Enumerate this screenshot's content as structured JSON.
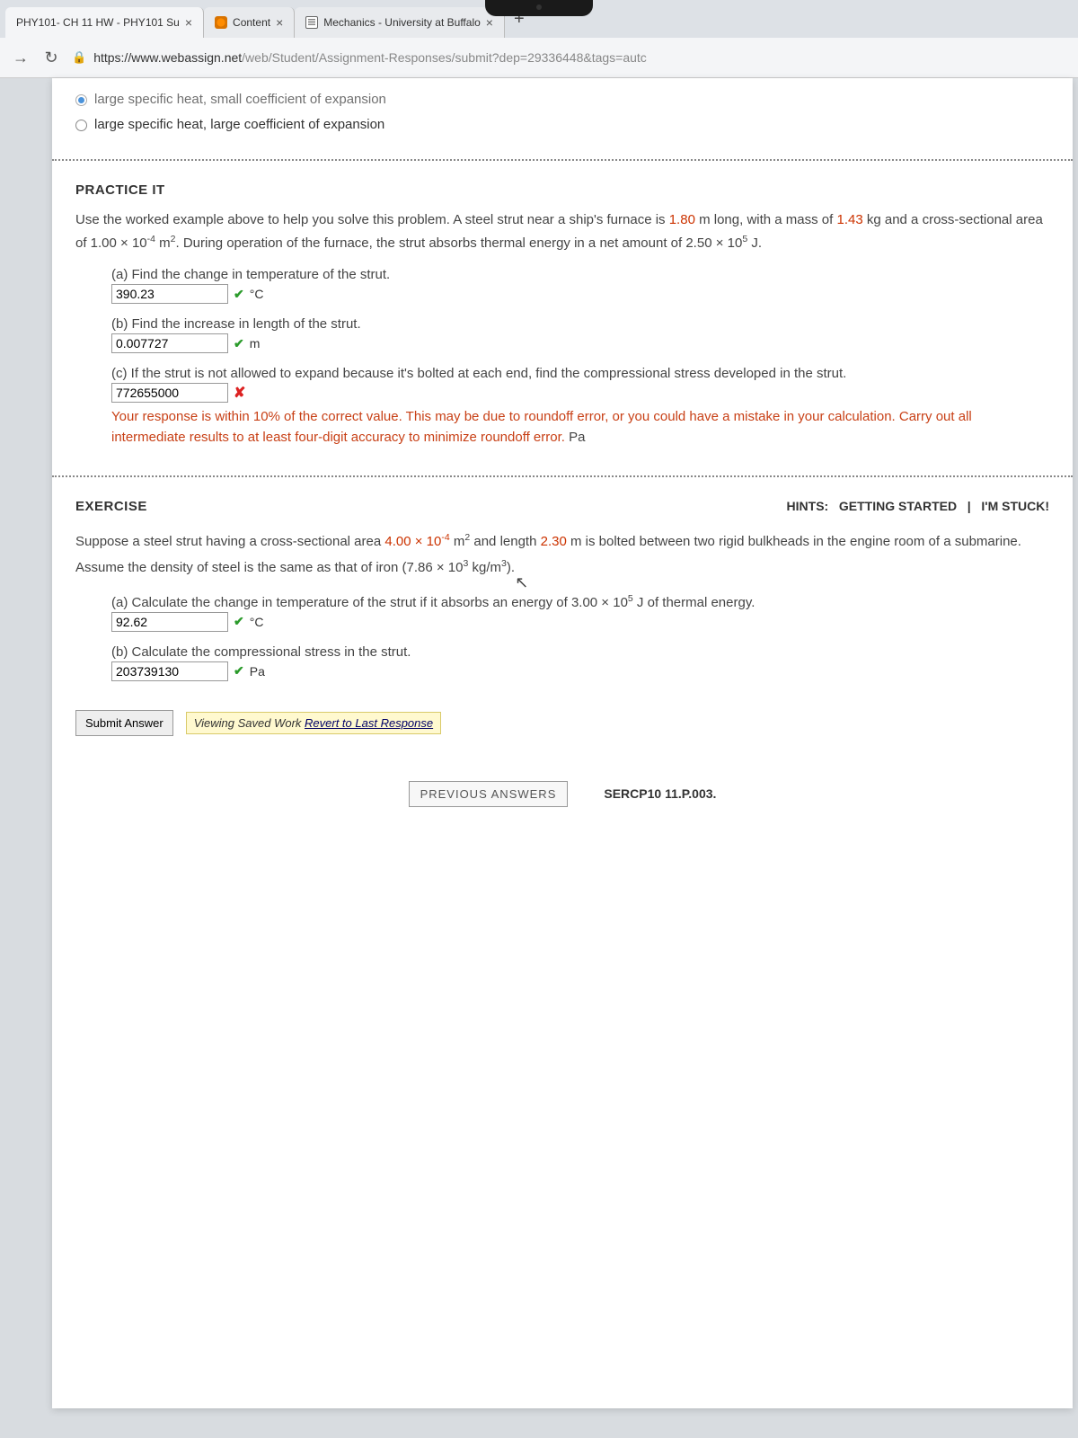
{
  "tabs": {
    "t1": "PHY101- CH 11 HW - PHY101 Su",
    "t2": "Content",
    "t3": "Mechanics - University at Buffalo"
  },
  "url": {
    "host": "https://www.webassign.net",
    "path": "/web/Student/Assignment-Responses/submit?dep=29336448&tags=autc"
  },
  "radio": {
    "r1": "large specific heat, small coefficient of expansion",
    "r2": "large specific heat, large coefficient of expansion"
  },
  "practice": {
    "title": "PRACTICE IT",
    "intro_1": "Use the worked example above to help you solve this problem. A steel strut near a ship's furnace is ",
    "v_len": "1.80",
    "intro_2": " m long, with a mass of ",
    "v_mass": "1.43",
    "intro_3": " kg and a cross-sectional area of 1.00 × 10",
    "sup1": "-4",
    "intro_4": " m",
    "sup2": "2",
    "intro_5": ". During operation of the furnace, the strut absorbs thermal energy in a net amount of 2.50 × 10",
    "sup3": "5",
    "intro_6": " J.",
    "a_prompt": "(a) Find the change in temperature of the strut.",
    "a_val": "390.23",
    "a_unit": "°C",
    "b_prompt": "(b) Find the increase in length of the strut.",
    "b_val": "0.007727",
    "b_unit": "m",
    "c_prompt": "(c) If the strut is not allowed to expand because it's bolted at each end, find the compressional stress developed in the strut.",
    "c_val": "772655000",
    "c_feedback": "Your response is within 10% of the correct value. This may be due to roundoff error, or you could have a mistake in your calculation. Carry out all intermediate results to at least four-digit accuracy to minimize roundoff error.",
    "c_unit": " Pa"
  },
  "exercise": {
    "title": "EXERCISE",
    "hints_lbl": "HINTS:",
    "gs": "GETTING STARTED",
    "sep": "|",
    "stuck": "I'M STUCK!",
    "p1": "Suppose a steel strut having a cross-sectional area ",
    "v_a": "4.00 × 10",
    "sup1": "-4",
    "p2": " m",
    "sup2": "2",
    "p3": " and length ",
    "v_l": "2.30",
    "p4": " m is bolted between two rigid bulkheads in the engine room of a submarine. Assume the density of steel is the same as that of iron (7.86 × 10",
    "sup3": "3",
    "p5": " kg/m",
    "sup4": "3",
    "p6": ").",
    "a_prompt_1": "(a) Calculate the change in temperature of the strut if it absorbs an energy of 3.00 × 10",
    "a_sup": "5",
    "a_prompt_2": " J of thermal energy.",
    "a_val": "92.62",
    "a_unit": "°C",
    "b_prompt": "(b) Calculate the compressional stress in the strut.",
    "b_val": "203739130",
    "b_unit": "Pa"
  },
  "buttons": {
    "submit": "Submit Answer",
    "saved": "Viewing Saved Work ",
    "revert": "Revert to Last Response",
    "prev": "PREVIOUS ANSWERS",
    "ref": "SERCP10 11.P.003."
  }
}
